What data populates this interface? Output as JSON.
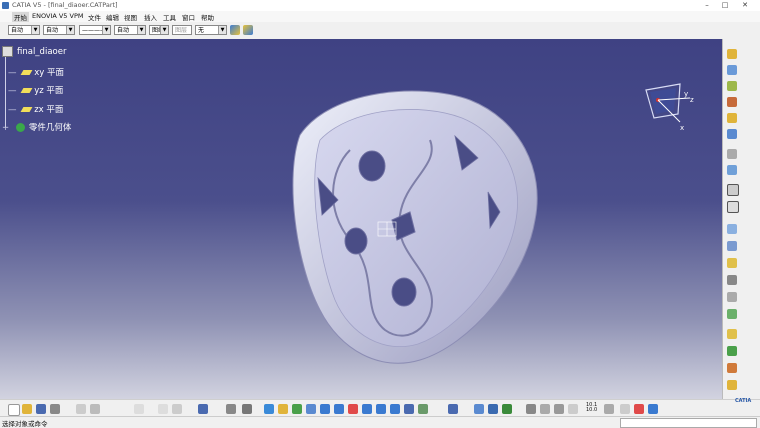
{
  "window": {
    "title": "CATIA V5 - [final_diaoer.CATPart]",
    "controls": [
      "–",
      "□",
      "✕"
    ]
  },
  "menu": {
    "items": [
      "开始",
      "ENOVIA V5 VPM",
      "文件",
      "编辑",
      "视图",
      "插入",
      "工具",
      "窗口",
      "帮助"
    ]
  },
  "toolbar1": {
    "color_select": "自动",
    "transparency_select": "自动",
    "linetype_select": "————",
    "lineweight_select": "自动",
    "point_select": "图纸",
    "layer_select": "图层",
    "layer_value": "无"
  },
  "tree": {
    "root": "final_diaoer",
    "items": [
      "xy 平面",
      "yz 平面",
      "zx 平面",
      "零件几何体"
    ]
  },
  "compass": {
    "labels": [
      "x",
      "y",
      "z"
    ]
  },
  "status": {
    "text": "选择对象或命令"
  },
  "logo": {
    "text": "CATIA"
  },
  "bottom_toolbar": {
    "scale_label": "10.1\n10.0"
  },
  "colors": {
    "viewport_top": "#3f4283",
    "viewport_bottom": "#d2d3e0",
    "part": "#c9c9e6"
  }
}
